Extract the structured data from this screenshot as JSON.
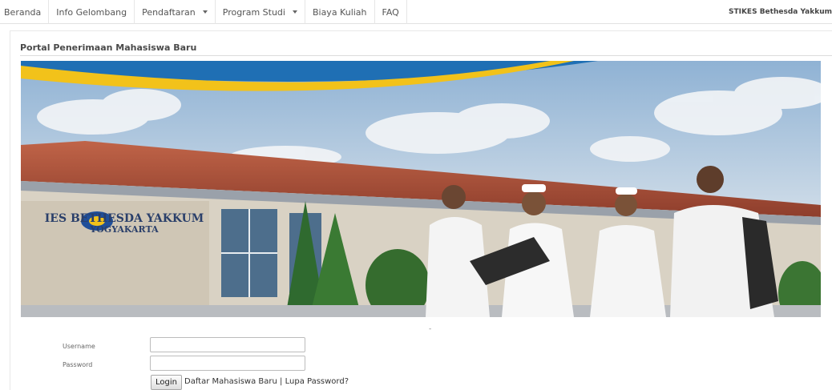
{
  "navbar": {
    "items": [
      {
        "label": "Beranda",
        "dropdown": false
      },
      {
        "label": "Info Gelombang",
        "dropdown": false
      },
      {
        "label": "Pendaftaran",
        "dropdown": true
      },
      {
        "label": "Program Studi",
        "dropdown": true
      },
      {
        "label": "Biaya Kuliah",
        "dropdown": false
      },
      {
        "label": "FAQ",
        "dropdown": false
      }
    ],
    "brand": "STIKES Bethesda Yakkum"
  },
  "page": {
    "title": "Portal Penerimaan Mahasiswa Baru"
  },
  "banner": {
    "sign_line1": "IES BETHESDA YAKKUM",
    "sign_line2": "YOGYAKARTA",
    "carousel_indicator": "-"
  },
  "login_form": {
    "username_label": "Username",
    "username_value": "",
    "password_label": "Password",
    "password_value": "",
    "login_button": "Login",
    "register_link": "Daftar Mahasiswa Baru",
    "separator": "|",
    "forgot_link": "Lupa Password?"
  },
  "colors": {
    "banner_blue_arc": "#1f6fb4",
    "banner_yellow_arc": "#f2c21a",
    "roof": "#b5543c",
    "uniform": "#f4f4f4"
  }
}
